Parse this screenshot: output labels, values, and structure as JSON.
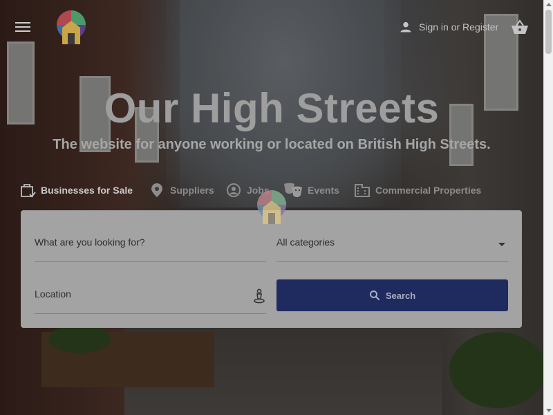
{
  "header": {
    "sign_in_label": "Sign in",
    "or_label": "or",
    "register_label": "Register",
    "icons": {
      "menu": "menu-icon",
      "user": "user-icon",
      "basket": "basket-icon",
      "logo": "logo-icon"
    }
  },
  "hero": {
    "title": "Our High Streets",
    "subtitle": "The website for anyone working or located on British High Streets."
  },
  "tabs": [
    {
      "label": "Businesses for Sale",
      "icon": "shop-sale-icon",
      "active": true
    },
    {
      "label": "Suppliers",
      "icon": "location-pin-icon",
      "active": false
    },
    {
      "label": "Jobs",
      "icon": "person-search-icon",
      "active": false
    },
    {
      "label": "Events",
      "icon": "theater-masks-icon",
      "active": false
    },
    {
      "label": "Commercial Properties",
      "icon": "building-icon",
      "active": false
    }
  ],
  "search": {
    "what_placeholder": "What are you looking for?",
    "category_selected": "All categories",
    "location_placeholder": "Location",
    "button_label": "Search"
  },
  "colors": {
    "button_bg": "#1f2a5e",
    "panel_bg": "#a3a3a3",
    "overlay": "rgba(0,0,0,0.42)"
  }
}
